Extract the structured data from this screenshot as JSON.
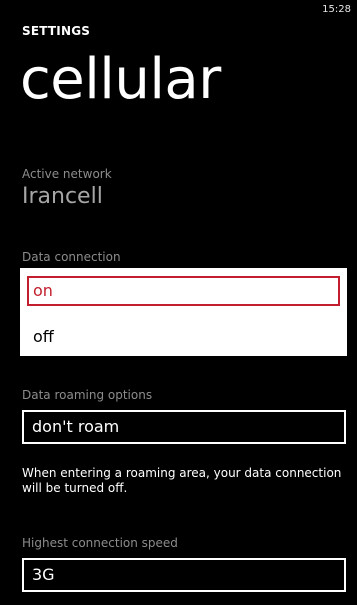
{
  "status": {
    "time": "15:28"
  },
  "header": {
    "app_title": "SETTINGS",
    "page_title": "cellular"
  },
  "active_network": {
    "label": "Active network",
    "value": "Irancell"
  },
  "data_connection": {
    "label": "Data connection",
    "options": [
      "on",
      "off"
    ],
    "selected": "on"
  },
  "data_roaming": {
    "label": "Data roaming options",
    "value": "don't roam",
    "description": "When entering a roaming area, your data connection will be turned off."
  },
  "connection_speed": {
    "label": "Highest connection speed",
    "value": "3G"
  },
  "colors": {
    "background": "#000000",
    "accent": "#c21e2d",
    "foreground": "#ffffff"
  }
}
